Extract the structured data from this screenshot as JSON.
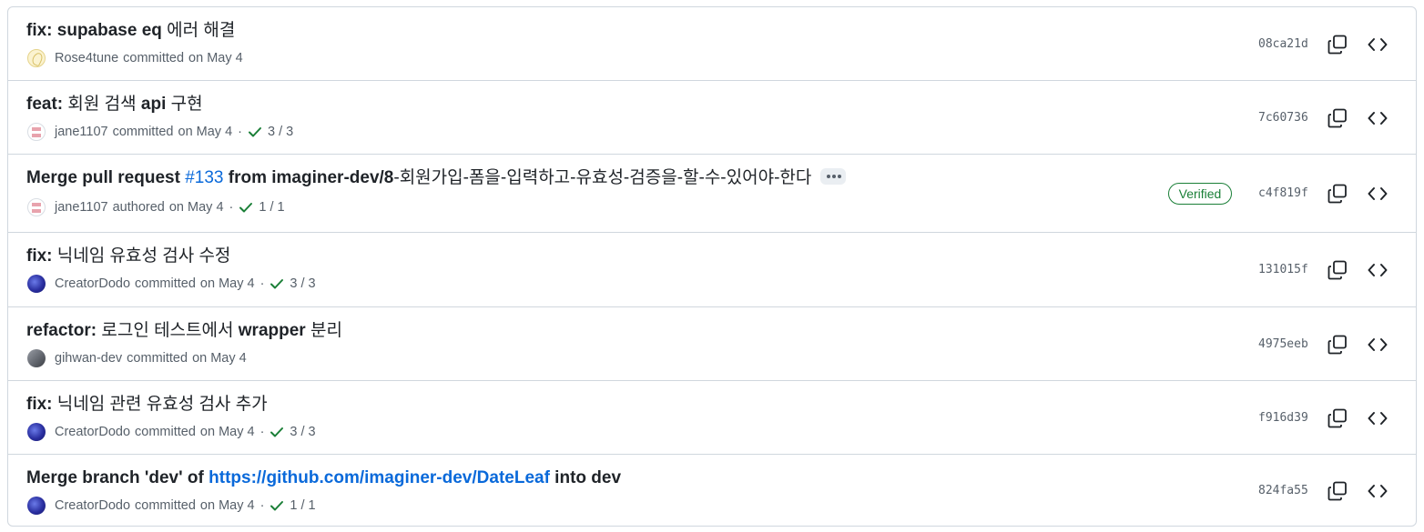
{
  "commits": [
    {
      "title_parts": [
        {
          "t": "fix:",
          "b": true
        },
        {
          "t": " supabase eq",
          "b": true
        },
        {
          "t": " 에러 해결",
          "b": false
        }
      ],
      "author": "Rose4tune",
      "action": "committed",
      "date": "on May 4",
      "checks": "",
      "sha": "08ca21d",
      "avatar": "rose",
      "verified": false
    },
    {
      "title_parts": [
        {
          "t": "feat:",
          "b": true
        },
        {
          "t": " 회원 검색 ",
          "b": false
        },
        {
          "t": "api",
          "b": true
        },
        {
          "t": " 구현",
          "b": false
        }
      ],
      "author": "jane1107",
      "action": "committed",
      "date": "on May 4",
      "checks": "3 / 3",
      "sha": "7c60736",
      "avatar": "jane",
      "verified": false
    },
    {
      "title_parts": [
        {
          "t": "Merge pull request ",
          "b": true
        },
        {
          "t": "#133",
          "b": false,
          "link": true
        },
        {
          "t": " from imaginer-dev/8",
          "b": true
        },
        {
          "t": "-회원가입-폼을-입력하고-유효성-검증을-할-수-있어야-한다",
          "b": false
        }
      ],
      "author": "jane1107",
      "action": "authored",
      "date": "on May 4",
      "checks": "1 / 1",
      "sha": "c4f819f",
      "avatar": "jane",
      "verified": true,
      "more": true
    },
    {
      "title_parts": [
        {
          "t": "fix:",
          "b": true
        },
        {
          "t": " 닉네임 유효성 검사 수정",
          "b": false
        }
      ],
      "author": "CreatorDodo",
      "action": "committed",
      "date": "on May 4",
      "checks": "3 / 3",
      "sha": "131015f",
      "avatar": "dodo",
      "verified": false
    },
    {
      "title_parts": [
        {
          "t": "refactor:",
          "b": true
        },
        {
          "t": " 로그인 테스트에서 ",
          "b": false
        },
        {
          "t": "wrapper",
          "b": true
        },
        {
          "t": " 분리",
          "b": false
        }
      ],
      "author": "gihwan-dev",
      "action": "committed",
      "date": "on May 4",
      "checks": "",
      "sha": "4975eeb",
      "avatar": "gihwan",
      "verified": false
    },
    {
      "title_parts": [
        {
          "t": "fix:",
          "b": true
        },
        {
          "t": " 닉네임 관련 유효성 검사 추가",
          "b": false
        }
      ],
      "author": "CreatorDodo",
      "action": "committed",
      "date": "on May 4",
      "checks": "3 / 3",
      "sha": "f916d39",
      "avatar": "dodo",
      "verified": false
    },
    {
      "title_parts": [
        {
          "t": "Merge branch 'dev' of ",
          "b": true
        },
        {
          "t": "https://github.com/imaginer-dev/DateLeaf",
          "b": true,
          "link": true
        },
        {
          "t": " into dev",
          "b": true
        }
      ],
      "author": "CreatorDodo",
      "action": "committed",
      "date": "on May 4",
      "checks": "1 / 1",
      "sha": "824fa55",
      "avatar": "dodo",
      "verified": false
    }
  ],
  "verified_label": "Verified",
  "separator": "·",
  "colors": {
    "success": "#1a7f37",
    "link": "#0969da",
    "muted": "#57606a",
    "border": "#d0d7de"
  },
  "icons": {
    "copy": "copy-icon",
    "code": "code-icon",
    "check": "check-icon",
    "more": "ellipsis-icon"
  }
}
